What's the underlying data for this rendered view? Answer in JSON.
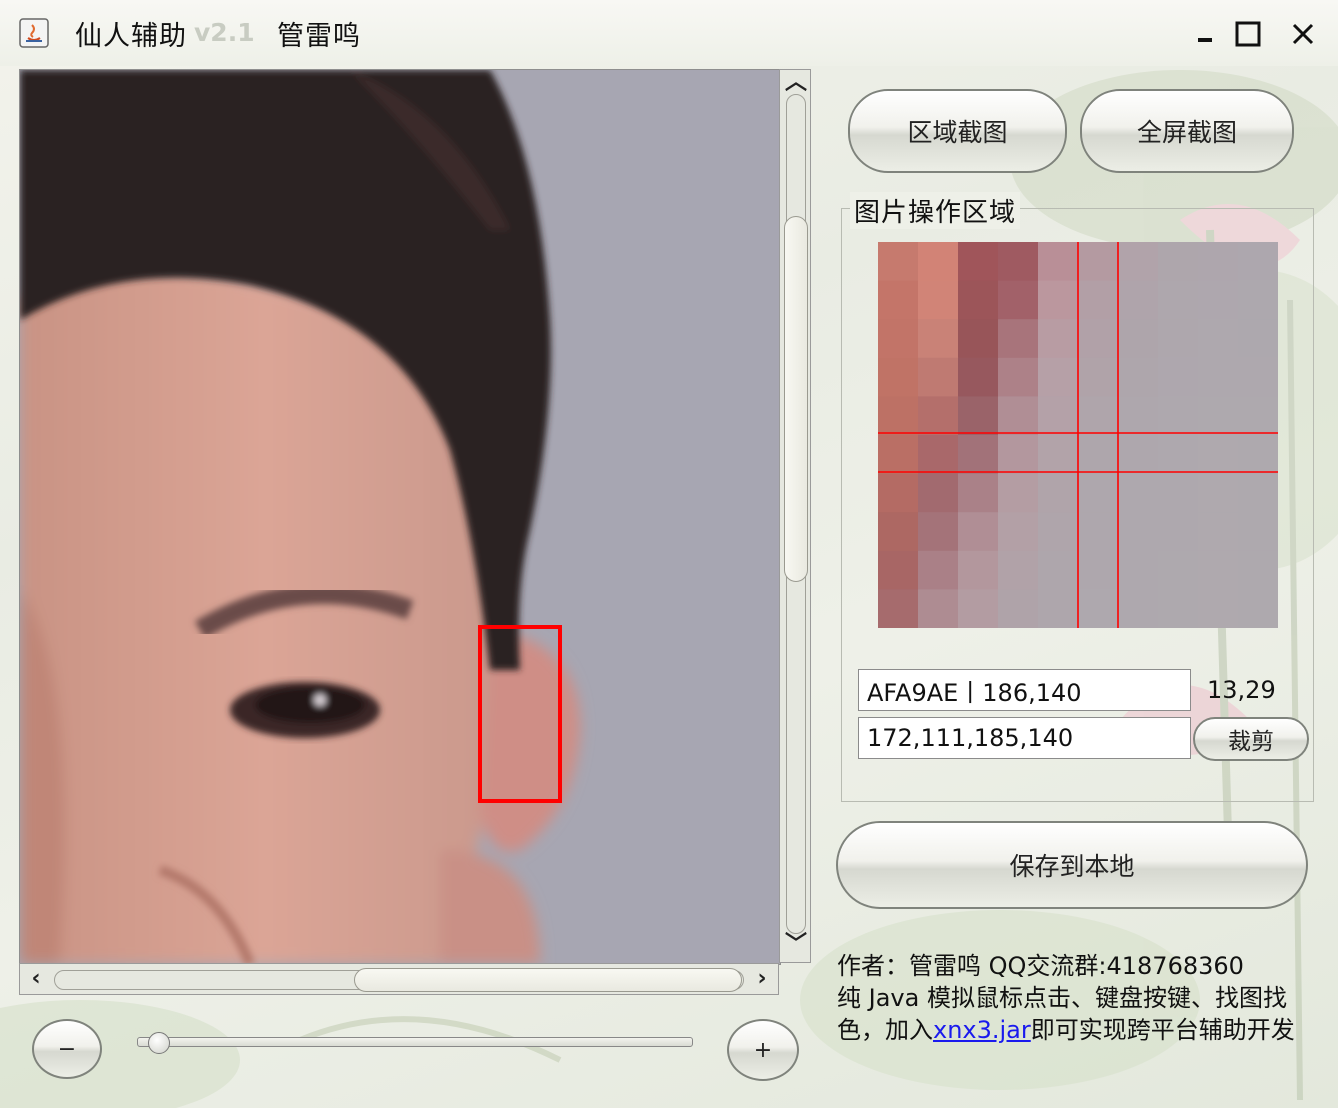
{
  "window": {
    "title": "仙人辅助",
    "version": "v2.1",
    "author": "管雷鸣",
    "controls": {
      "minimize": "minimize",
      "maximize": "maximize",
      "close": "close"
    }
  },
  "toolbar": {
    "region_capture_label": "区域截图",
    "fullscreen_capture_label": "全屏截图"
  },
  "image_area": {
    "group_title": "图片操作区域",
    "color_readout": "AFA9AE丨186,140",
    "offset_readout": "13,29",
    "crop_rect_readout": "172,111,185,140",
    "crop_label": "裁剪"
  },
  "save_label": "保存到本地",
  "zoom": {
    "minus_label": "−",
    "plus_label": "+",
    "level": 0.02
  },
  "info": {
    "line1": "作者：管雷鸣 QQ交流群:418768360",
    "line2_prefix": "纯 Java 模拟鼠标点击、键盘按键、找图找色，加入",
    "link_text": "xnx3.jar",
    "line2_suffix": "即可实现跨平台辅助开发"
  },
  "zoom_pixels": [
    [
      "#c67a6e",
      "#d28376",
      "#a0555a",
      "#9f5a61",
      "#b98f97",
      "#b49aa1",
      "#b1a3aa",
      "#aea6ac",
      "#aea6ad",
      "#ada7ae"
    ],
    [
      "#c47569",
      "#d18477",
      "#9c5559",
      "#a26169",
      "#bb979e",
      "#b29fa6",
      "#afa4ab",
      "#aea7ad",
      "#aea7ae",
      "#ada8ae"
    ],
    [
      "#c27468",
      "#c98277",
      "#985559",
      "#a8747b",
      "#b89ca3",
      "#b1a1a8",
      "#aea5ab",
      "#aea7ad",
      "#aea8ae",
      "#ada8ae"
    ],
    [
      "#c07366",
      "#bf7a72",
      "#97585e",
      "#ad8188",
      "#b6a0a7",
      "#b0a3a9",
      "#aea6ac",
      "#aea7ae",
      "#aea8ae",
      "#aea8ae"
    ],
    [
      "#bd7165",
      "#b46f6b",
      "#9a6369",
      "#b08e95",
      "#b4a1a8",
      "#afa5ab",
      "#aea7ad",
      "#aea8ae",
      "#aea9ae",
      "#aea9ae"
    ],
    [
      "#ba6f65",
      "#a9686a",
      "#a27279",
      "#b3979e",
      "#b2a3a9",
      "#aea6ac",
      "#aea7ad",
      "#aea8ae",
      "#afa9ae",
      "#aea9ae"
    ],
    [
      "#b46b64",
      "#a26a6f",
      "#aa8188",
      "#b49da3",
      "#b0a4aa",
      "#aea7ad",
      "#aea8ae",
      "#aea8ae",
      "#afa9ae",
      "#aea9ae"
    ],
    [
      "#ad6863",
      "#a47379",
      "#b08e95",
      "#b3a0a6",
      "#afa5ab",
      "#aea7ad",
      "#aea8ae",
      "#aea8ae",
      "#afa9ae",
      "#aea9ae"
    ],
    [
      "#a86665",
      "#aa8087",
      "#b3979d",
      "#b1a2a8",
      "#aea6ac",
      "#aea7ad",
      "#aea8ae",
      "#aea9ae",
      "#afa9ae",
      "#aea9ae"
    ],
    [
      "#a66b6d",
      "#ae8c92",
      "#b39ca2",
      "#afa3a9",
      "#aea6ac",
      "#aea8ae",
      "#aea8ae",
      "#aea9ae",
      "#afa9ae",
      "#aea9ae"
    ]
  ]
}
